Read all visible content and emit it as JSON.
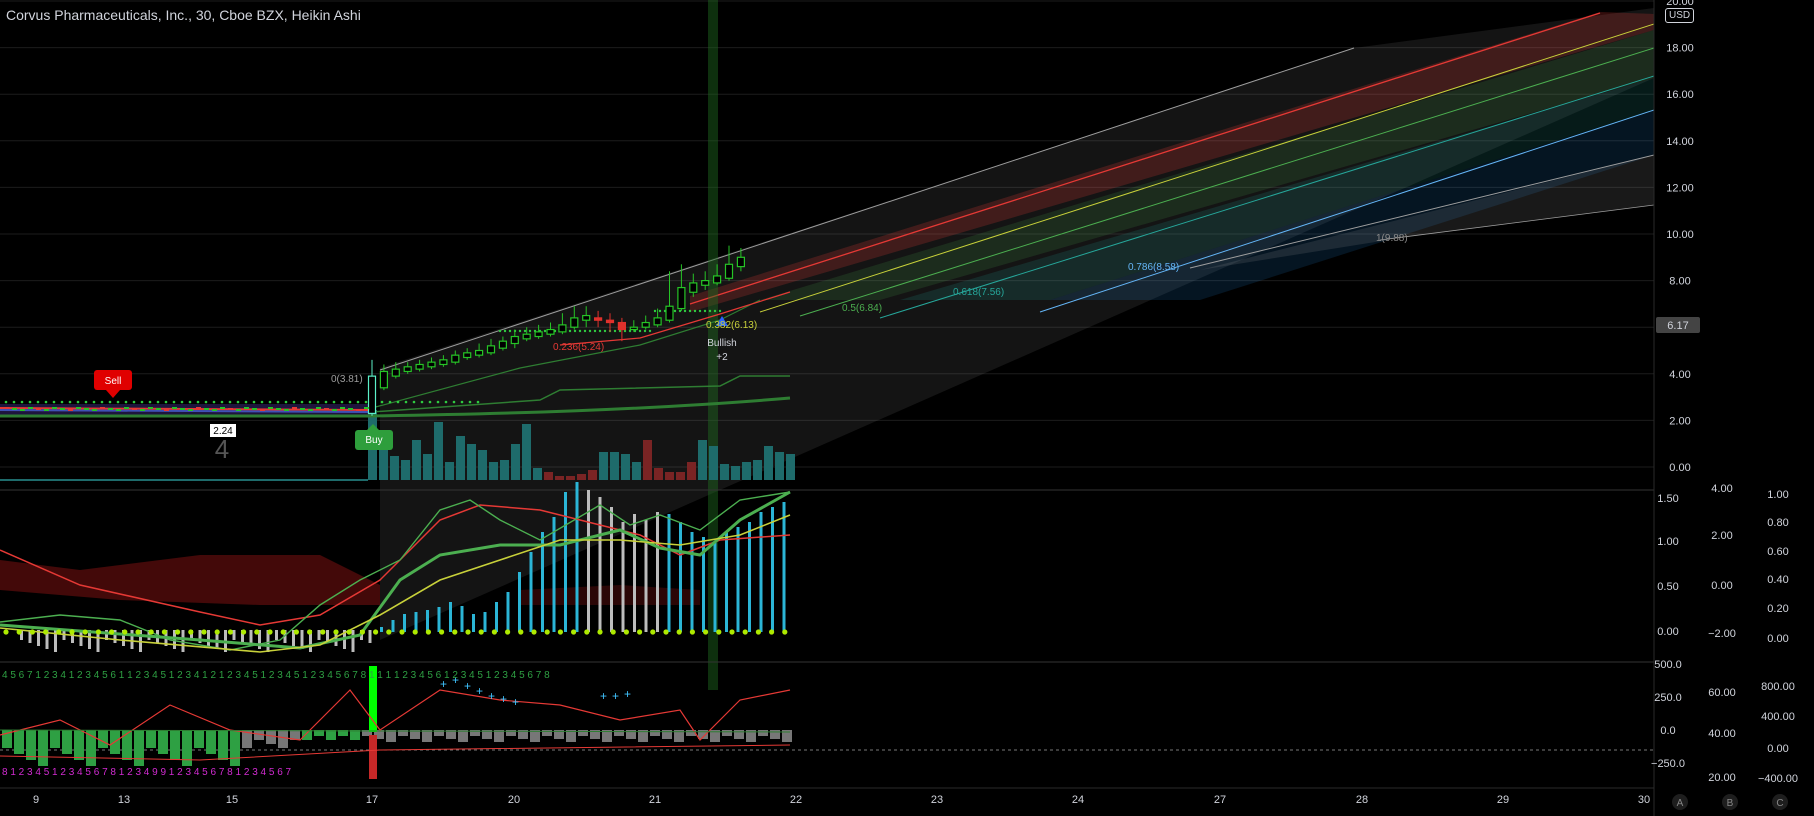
{
  "header": {
    "symbol_title": "Corvus Pharmaceuticals, Inc., 30, Cboe BZX, Heikin Ashi",
    "currency": "USD"
  },
  "colors": {
    "background": "#000000",
    "grid": "#1c1c1c",
    "up": "#26c426",
    "down": "#e0312c",
    "volume_up": "#1e6b6b",
    "volume_down": "#7a2424",
    "fib_red": "#e53935",
    "fib_yellow": "#c8d13a",
    "fib_green": "#4caf50",
    "fib_teal": "#26a69a",
    "fib_blue": "#64b5f6",
    "fib_grey": "#8a8a8a",
    "macd_bar": "#2bb5d6",
    "macd_bar_neutral": "#bdbdbd"
  },
  "price_axis": {
    "ticks": [
      "20.00",
      "18.00",
      "16.00",
      "14.00",
      "12.00",
      "10.00",
      "8.00",
      "6.00",
      "4.00",
      "2.00",
      "0.00"
    ],
    "last_price": "6.17"
  },
  "x_axis": {
    "ticks": [
      "9",
      "13",
      "15",
      "17",
      "20",
      "21",
      "22",
      "23",
      "24",
      "27",
      "28",
      "29",
      "30"
    ]
  },
  "signals": {
    "sell_label": "Sell",
    "buy_label": "Buy",
    "low_marker": "2.24",
    "big_number": "4",
    "bullish_label": "Bullish",
    "bullish_count": "+2"
  },
  "fib_labels": [
    "0(3.81)",
    "0.236(5.24)",
    "0.382(6.13)",
    "0.5(6.84)",
    "0.618(7.56)",
    "0.786(8.58)",
    "1(9.88)"
  ],
  "panes": {
    "macd": {
      "left_ticks": [
        "1.50",
        "1.00",
        "0.50",
        "0.00"
      ],
      "mid_ticks": [
        "4.00",
        "2.00",
        "0.00",
        "−2.00"
      ],
      "right_ticks": [
        "1.00",
        "0.80",
        "0.60",
        "0.40",
        "0.20",
        "0.00"
      ]
    },
    "osc": {
      "left_ticks": [
        "500.0",
        "250.0",
        "0.0",
        "−250.0"
      ],
      "mid_ticks": [
        "60.00",
        "40.00",
        "20.00"
      ],
      "right_ticks": [
        "800.00",
        "400.00",
        "0.00",
        "−400.00"
      ]
    }
  },
  "counter_rows": {
    "top": "4 5 6 7 1 2 3 4 1 2 3 4 5 6   1 1 2 3 4 5 1 2 3 4 1 2   1 2 3 4 5 1 2 3 4 5 1 2 3 4 5 6 7 8 1 1 1 1 2 3 4 5 6 1 2 3 4 5 1 2 3 4 5 6 7 8",
    "bottom": "8 1 2 3 4 5   1 2 3 4 5 6 7 8 1 2 3 4            9   9          1 2 3 4 5 6 7 8    1 2 3 4 5 6 7"
  },
  "pane_buttons": [
    "A",
    "B",
    "C"
  ],
  "chart_data": {
    "type": "candlestick",
    "title": "Corvus Pharmaceuticals, Inc., 30, Cboe BZX, Heikin Ashi",
    "ylim": [
      0,
      20
    ],
    "x_categories": [
      "9",
      "13",
      "15",
      "17",
      "20",
      "21",
      "22",
      "23",
      "24",
      "27",
      "28",
      "29",
      "30"
    ],
    "candles": [
      {
        "x": "17",
        "open": 2.3,
        "close": 3.9,
        "high": 4.6,
        "low": 2.2
      },
      {
        "x": "17",
        "open": 3.4,
        "close": 4.1,
        "high": 4.4,
        "low": 3.3
      },
      {
        "x": "17",
        "open": 3.9,
        "close": 4.2,
        "high": 4.5,
        "low": 3.8
      },
      {
        "x": "17",
        "open": 4.1,
        "close": 4.3,
        "high": 4.5,
        "low": 4.0
      },
      {
        "x": "17",
        "open": 4.2,
        "close": 4.4,
        "high": 4.6,
        "low": 4.1
      },
      {
        "x": "17",
        "open": 4.3,
        "close": 4.5,
        "high": 4.7,
        "low": 4.2
      },
      {
        "x": "17",
        "open": 4.4,
        "close": 4.6,
        "high": 4.8,
        "low": 4.3
      },
      {
        "x": "17",
        "open": 4.5,
        "close": 4.8,
        "high": 5.0,
        "low": 4.4
      },
      {
        "x": "20",
        "open": 4.7,
        "close": 4.9,
        "high": 5.1,
        "low": 4.6
      },
      {
        "x": "20",
        "open": 4.8,
        "close": 5.0,
        "high": 5.3,
        "low": 4.7
      },
      {
        "x": "20",
        "open": 4.9,
        "close": 5.2,
        "high": 5.5,
        "low": 4.8
      },
      {
        "x": "20",
        "open": 5.1,
        "close": 5.4,
        "high": 5.6,
        "low": 5.0
      },
      {
        "x": "20",
        "open": 5.3,
        "close": 5.6,
        "high": 5.9,
        "low": 5.1
      },
      {
        "x": "20",
        "open": 5.5,
        "close": 5.7,
        "high": 6.0,
        "low": 5.4
      },
      {
        "x": "20",
        "open": 5.6,
        "close": 5.8,
        "high": 6.1,
        "low": 5.5
      },
      {
        "x": "20",
        "open": 5.7,
        "close": 5.9,
        "high": 6.2,
        "low": 5.6
      },
      {
        "x": "20",
        "open": 5.8,
        "close": 6.1,
        "high": 6.6,
        "low": 5.7
      },
      {
        "x": "21",
        "open": 6.0,
        "close": 6.4,
        "high": 6.9,
        "low": 5.9
      },
      {
        "x": "21",
        "open": 6.3,
        "close": 6.5,
        "high": 6.9,
        "low": 6.0
      },
      {
        "x": "21",
        "open": 6.4,
        "close": 6.3,
        "high": 6.7,
        "low": 6.0
      },
      {
        "x": "21",
        "open": 6.3,
        "close": 6.2,
        "high": 6.6,
        "low": 5.8
      },
      {
        "x": "21",
        "open": 6.2,
        "close": 5.9,
        "high": 6.4,
        "low": 5.4
      },
      {
        "x": "21",
        "open": 5.9,
        "close": 6.0,
        "high": 6.3,
        "low": 5.8
      },
      {
        "x": "21",
        "open": 6.0,
        "close": 6.2,
        "high": 6.5,
        "low": 5.9
      },
      {
        "x": "21",
        "open": 6.1,
        "close": 6.4,
        "high": 6.8,
        "low": 6.0
      },
      {
        "x": "21",
        "open": 6.3,
        "close": 6.9,
        "high": 8.4,
        "low": 6.2
      },
      {
        "x": "21",
        "open": 6.8,
        "close": 7.7,
        "high": 8.7,
        "low": 6.7
      },
      {
        "x": "21",
        "open": 7.5,
        "close": 7.9,
        "high": 8.3,
        "low": 7.3
      },
      {
        "x": "21",
        "open": 7.8,
        "close": 8.0,
        "high": 8.4,
        "low": 7.6
      },
      {
        "x": "21",
        "open": 7.9,
        "close": 8.2,
        "high": 8.7,
        "low": 7.8
      },
      {
        "x": "22",
        "open": 8.1,
        "close": 8.7,
        "high": 9.5,
        "low": 8.0
      },
      {
        "x": "22",
        "open": 8.6,
        "close": 9.0,
        "high": 9.4,
        "low": 8.4
      }
    ],
    "pre_breakout_range": [
      2.2,
      2.9
    ],
    "fib_channel": [
      {
        "level": "0",
        "value": 3.81
      },
      {
        "level": "0.236",
        "value": 5.24
      },
      {
        "level": "0.382",
        "value": 6.13
      },
      {
        "level": "0.5",
        "value": 6.84
      },
      {
        "level": "0.618",
        "value": 7.56
      },
      {
        "level": "0.786",
        "value": 8.58
      },
      {
        "level": "1",
        "value": 9.88
      }
    ]
  }
}
